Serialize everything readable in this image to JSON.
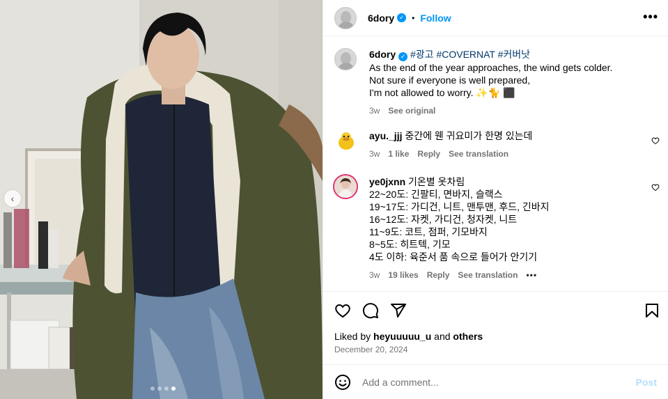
{
  "post": {
    "username": "6dory",
    "follow_label": "Follow",
    "more_label": "•••",
    "carousel_total": 4,
    "carousel_active": 4
  },
  "caption": {
    "username": "6dory",
    "hashtags": "#광고 #COVERNAT #커버낫",
    "lines": [
      "As the end of the year approaches, the wind gets colder.",
      "Not sure if everyone is well prepared,",
      "I'm not allowed to worry. ✨🐈 ⬛"
    ],
    "time": "3w",
    "see_original": "See original"
  },
  "comments": [
    {
      "username": "ayu._jjj",
      "text": "중간에 웬 귀요미가 한명 있는데",
      "time": "3w",
      "likes": "1 like",
      "reply": "Reply",
      "translate": "See translation"
    },
    {
      "username": "ye0jxnn",
      "first": "기온별 옷차림",
      "lines": [
        "22~20도: 긴팔티, 면바지, 슬랙스",
        "19~17도: 가디건, 니트, 맨투맨, 후드, 긴바지",
        "16~12도: 자켓, 가디건, 청자켓, 니트",
        "11~9도: 코트, 점퍼, 기모바지",
        "8~5도: 히트텍, 기모",
        "4도 이하: 육준서 품 속으로 들어가 안기기"
      ],
      "time": "3w",
      "likes": "19 likes",
      "reply": "Reply",
      "translate": "See translation",
      "more": "•••"
    }
  ],
  "liked_by": {
    "prefix": "Liked by ",
    "user": "heyuuuuu_u",
    "middle": " and ",
    "others": "others"
  },
  "date": "December 20, 2024",
  "add_comment": {
    "placeholder": "Add a comment...",
    "post_label": "Post"
  },
  "colors": {
    "accent": "#0095f6",
    "hashtag": "#00376b",
    "muted": "#737373",
    "post_disabled": "#b2dffc"
  }
}
